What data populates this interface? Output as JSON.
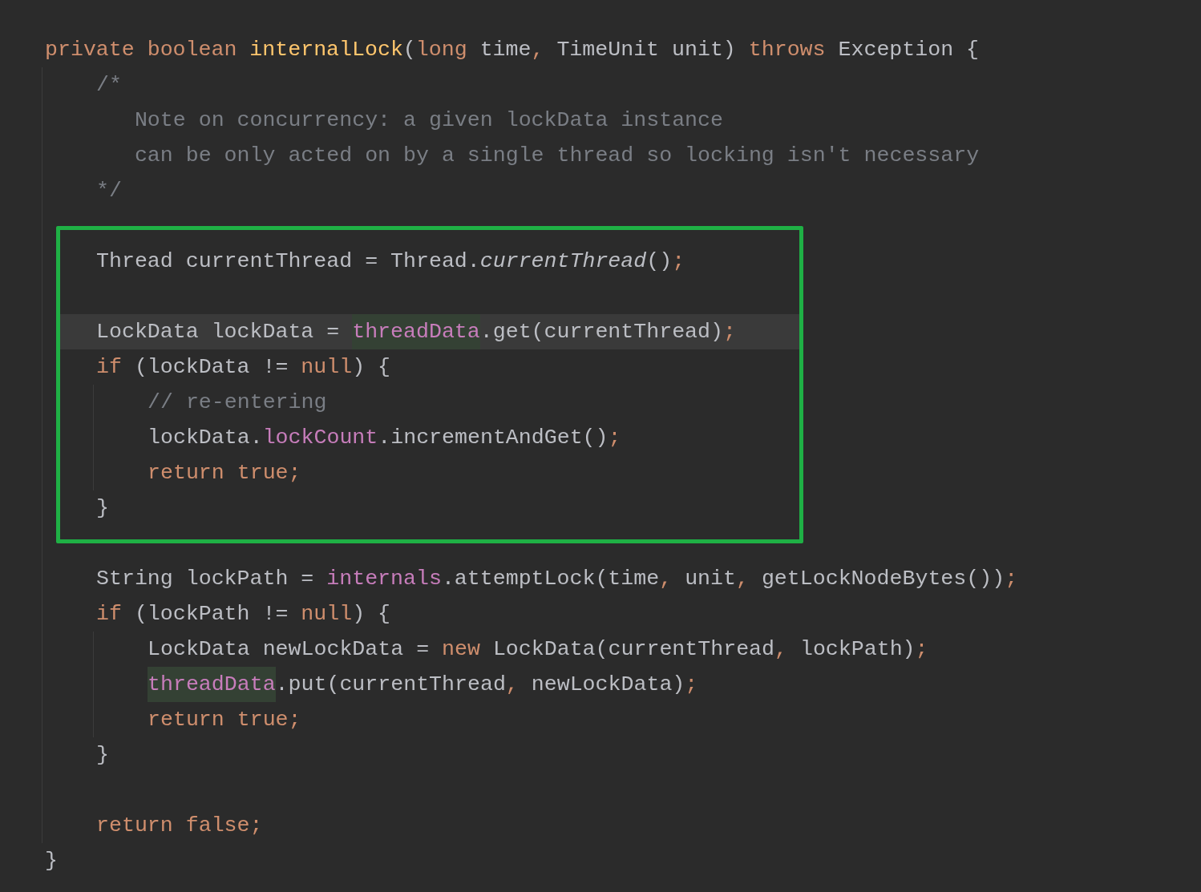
{
  "lines": [
    {
      "boxed": false,
      "current": false,
      "tokens": [
        {
          "kind": "keyword",
          "text": "private "
        },
        {
          "kind": "keyword",
          "text": "boolean "
        },
        {
          "kind": "declaration",
          "text": "internalLock"
        },
        {
          "kind": "plain",
          "text": "("
        },
        {
          "kind": "keyword",
          "text": "long"
        },
        {
          "kind": "plain",
          "text": " time"
        },
        {
          "kind": "punct",
          "text": ","
        },
        {
          "kind": "plain",
          "text": " TimeUnit unit) "
        },
        {
          "kind": "keyword",
          "text": "throws"
        },
        {
          "kind": "plain",
          "text": " Exception {"
        }
      ],
      "children": [
        {
          "boxed": false,
          "current": false,
          "tokens": [
            {
              "kind": "comment",
              "text": "/*"
            }
          ]
        },
        {
          "boxed": false,
          "current": false,
          "tokens": [
            {
              "kind": "comment",
              "text": "   Note on concurrency: a given lockData instance"
            }
          ]
        },
        {
          "boxed": false,
          "current": false,
          "tokens": [
            {
              "kind": "comment",
              "text": "   can be only acted on by a single thread so locking isn't necessary"
            }
          ]
        },
        {
          "boxed": false,
          "current": false,
          "tokens": [
            {
              "kind": "comment",
              "text": "*/"
            }
          ]
        },
        {
          "boxed": false,
          "current": false
        },
        {
          "boxed": true,
          "current": false,
          "tokens": [
            {
              "kind": "plain",
              "text": "Thread currentThread = Thread."
            },
            {
              "kind": "static_call",
              "text": "currentThread"
            },
            {
              "kind": "plain",
              "text": "()"
            },
            {
              "kind": "punct",
              "text": ";"
            }
          ]
        },
        {
          "boxed": true,
          "current": false
        },
        {
          "boxed": true,
          "current": true,
          "tokens": [
            {
              "kind": "plain",
              "text": "LockData lockData = "
            },
            {
              "kind": "field_usage",
              "text": "threadData"
            },
            {
              "kind": "plain",
              "text": ".get(currentThread)"
            },
            {
              "kind": "punct",
              "text": ";"
            }
          ]
        },
        {
          "boxed": true,
          "current": false,
          "tokens": [
            {
              "kind": "keyword",
              "text": "if"
            },
            {
              "kind": "plain",
              "text": " (lockData != "
            },
            {
              "kind": "keyword",
              "text": "null"
            },
            {
              "kind": "plain",
              "text": ") {"
            }
          ],
          "children": [
            {
              "boxed": true,
              "current": false,
              "tokens": [
                {
                  "kind": "comment",
                  "text": "// re-entering"
                }
              ]
            },
            {
              "boxed": true,
              "current": false,
              "tokens": [
                {
                  "kind": "plain",
                  "text": "lockData."
                },
                {
                  "kind": "field",
                  "text": "lockCount"
                },
                {
                  "kind": "plain",
                  "text": ".incrementAndGet()"
                },
                {
                  "kind": "punct",
                  "text": ";"
                }
              ]
            },
            {
              "boxed": true,
              "current": false,
              "tokens": [
                {
                  "kind": "keyword",
                  "text": "return true"
                },
                {
                  "kind": "punct",
                  "text": ";"
                }
              ]
            }
          ]
        },
        {
          "boxed": true,
          "current": false,
          "tokens": [
            {
              "kind": "plain",
              "text": "}"
            }
          ]
        },
        {
          "boxed": false,
          "current": false
        },
        {
          "boxed": false,
          "current": false,
          "tokens": [
            {
              "kind": "plain",
              "text": "String lockPath = "
            },
            {
              "kind": "field",
              "text": "internals"
            },
            {
              "kind": "plain",
              "text": ".attemptLock(time"
            },
            {
              "kind": "punct",
              "text": ","
            },
            {
              "kind": "plain",
              "text": " unit"
            },
            {
              "kind": "punct",
              "text": ","
            },
            {
              "kind": "plain",
              "text": " getLockNodeBytes())"
            },
            {
              "kind": "punct",
              "text": ";"
            }
          ]
        },
        {
          "boxed": false,
          "current": false,
          "tokens": [
            {
              "kind": "keyword",
              "text": "if"
            },
            {
              "kind": "plain",
              "text": " (lockPath != "
            },
            {
              "kind": "keyword",
              "text": "null"
            },
            {
              "kind": "plain",
              "text": ") {"
            }
          ],
          "children": [
            {
              "boxed": false,
              "current": false,
              "tokens": [
                {
                  "kind": "plain",
                  "text": "LockData newLockData = "
                },
                {
                  "kind": "keyword",
                  "text": "new"
                },
                {
                  "kind": "plain",
                  "text": " LockData(currentThread"
                },
                {
                  "kind": "punct",
                  "text": ","
                },
                {
                  "kind": "plain",
                  "text": " lockPath)"
                },
                {
                  "kind": "punct",
                  "text": ";"
                }
              ]
            },
            {
              "boxed": false,
              "current": false,
              "tokens": [
                {
                  "kind": "field_usage",
                  "text": "threadData"
                },
                {
                  "kind": "plain",
                  "text": ".put(currentThread"
                },
                {
                  "kind": "punct",
                  "text": ","
                },
                {
                  "kind": "plain",
                  "text": " newLockData)"
                },
                {
                  "kind": "punct",
                  "text": ";"
                }
              ]
            },
            {
              "boxed": false,
              "current": false,
              "tokens": [
                {
                  "kind": "keyword",
                  "text": "return true"
                },
                {
                  "kind": "punct",
                  "text": ";"
                }
              ]
            }
          ]
        },
        {
          "boxed": false,
          "current": false,
          "tokens": [
            {
              "kind": "plain",
              "text": "}"
            }
          ]
        },
        {
          "boxed": false,
          "current": false
        },
        {
          "boxed": false,
          "current": false,
          "tokens": [
            {
              "kind": "keyword",
              "text": "return false"
            },
            {
              "kind": "punct",
              "text": ";"
            }
          ]
        }
      ]
    },
    {
      "boxed": false,
      "current": false,
      "tokens": [
        {
          "kind": "plain",
          "text": "}"
        }
      ]
    }
  ]
}
